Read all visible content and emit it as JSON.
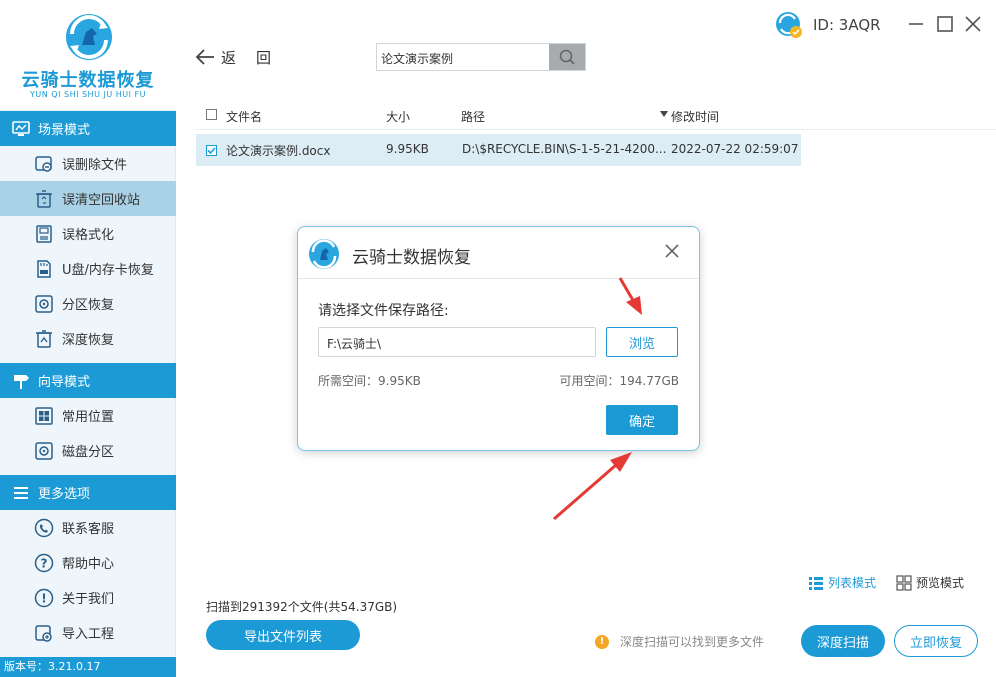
{
  "app": {
    "logo_title": "云骑士数据恢复",
    "logo_subtitle": "YUN QI SHI SHU JU HUI FU",
    "version": "版本号：3.21.0.17",
    "user_id": "ID: 3AQR",
    "accent": "#1c9ad6"
  },
  "sidebar": {
    "sections": [
      {
        "label": "场景模式",
        "icon": "monitor-icon"
      },
      {
        "label": "向导模式",
        "icon": "signpost-icon"
      },
      {
        "label": "更多选项",
        "icon": "menu-icon"
      }
    ],
    "scene_items": [
      {
        "label": "误删除文件",
        "icon": "deleted-file-icon"
      },
      {
        "label": "误清空回收站",
        "icon": "recycle-bin-icon",
        "active": true
      },
      {
        "label": "误格式化",
        "icon": "format-disk-icon"
      },
      {
        "label": "U盘/内存卡恢复",
        "icon": "sd-card-icon"
      },
      {
        "label": "分区恢复",
        "icon": "partition-icon"
      },
      {
        "label": "深度恢复",
        "icon": "deep-recover-icon"
      }
    ],
    "guide_items": [
      {
        "label": "常用位置",
        "icon": "windows-icon"
      },
      {
        "label": "磁盘分区",
        "icon": "disk-partition-icon"
      }
    ],
    "more_items": [
      {
        "label": "联系客服",
        "icon": "phone-icon"
      },
      {
        "label": "帮助中心",
        "icon": "help-icon"
      },
      {
        "label": "关于我们",
        "icon": "info-icon"
      },
      {
        "label": "导入工程",
        "icon": "import-icon"
      }
    ]
  },
  "toolbar": {
    "back_label": "返回",
    "search_value": "论文演示案例"
  },
  "table": {
    "columns": [
      "文件名",
      "大小",
      "路径",
      "修改时间"
    ],
    "sort_column": "修改时间",
    "rows": [
      {
        "name": "论文演示案例.docx",
        "size": "9.95KB",
        "path": "D:\\$RECYCLE.BIN\\S-1-5-21-4200...",
        "modified": "2022-07-22 02:59:07",
        "checked": true
      }
    ]
  },
  "footer": {
    "scan_summary": "扫描到291392个文件(共54.37GB)",
    "export_label": "导出文件列表",
    "tip": "深度扫描可以找到更多文件",
    "deep_scan_label": "深度扫描",
    "recover_label": "立即恢复",
    "list_mode_label": "列表模式",
    "preview_mode_label": "预览模式"
  },
  "dialog": {
    "title": "云骑士数据恢复",
    "prompt": "请选择文件保存路径:",
    "path_value": "F:\\云骑士\\",
    "browse_label": "浏览",
    "required_space": "所需空间：9.95KB",
    "available_space": "可用空间：194.77GB",
    "ok_label": "确定"
  },
  "annotations": {
    "arrow_color": "#e53935"
  }
}
